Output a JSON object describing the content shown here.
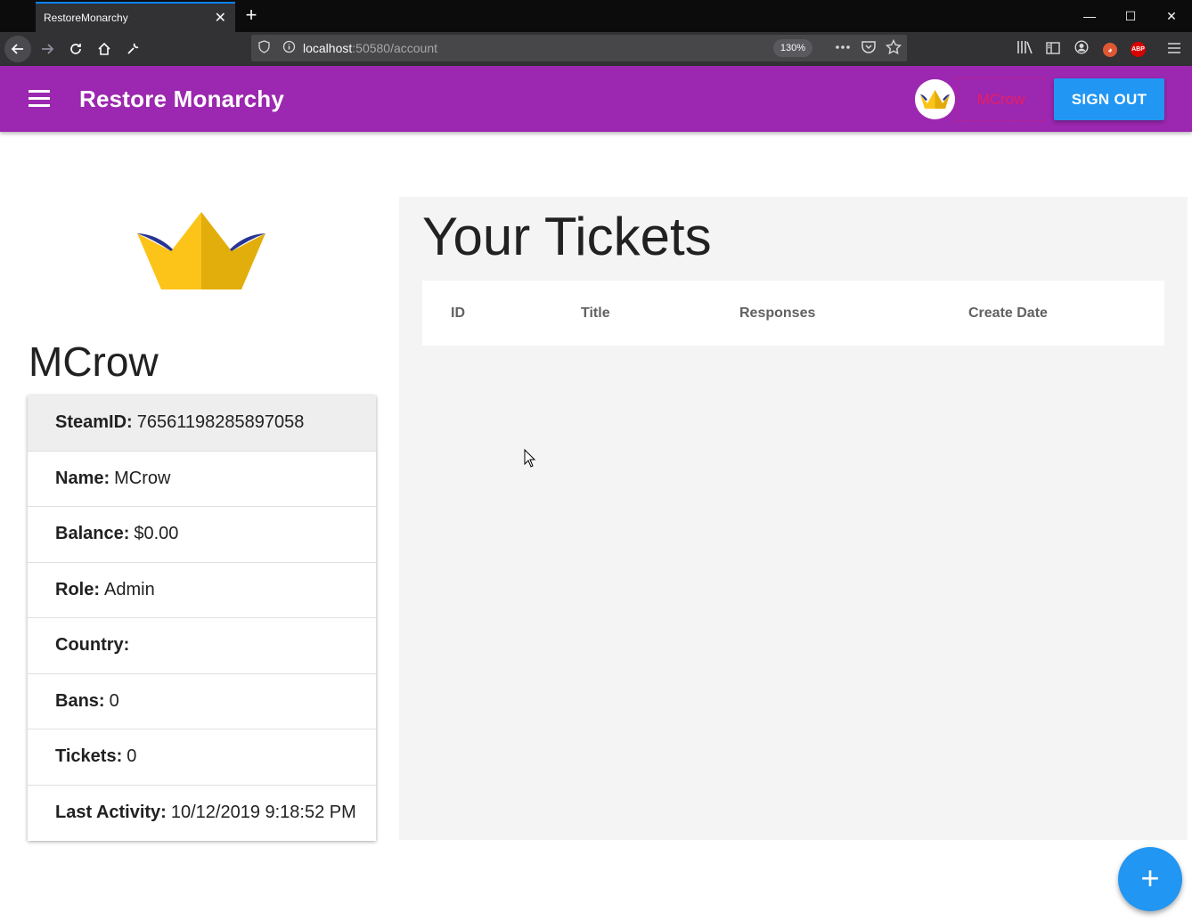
{
  "browser": {
    "tab_title": "RestoreMonarchy",
    "tab_close": "✕",
    "new_tab": "+",
    "url_host": "localhost",
    "url_rest": ":50580/account",
    "zoom": "130%",
    "win_minimize": "—",
    "win_maximize": "☐",
    "win_close": "✕",
    "ext_abp": "ABP",
    "ext_ddg": "◕"
  },
  "appbar": {
    "title": "Restore Monarchy",
    "user_label": "MCrow",
    "signout_label": "SIGN OUT",
    "accent": "#9c27b0"
  },
  "profile": {
    "username": "MCrow",
    "fields": [
      {
        "label": "SteamID:",
        "value": "76561198285897058"
      },
      {
        "label": "Name:",
        "value": "MCrow"
      },
      {
        "label": "Balance:",
        "value": "$0.00"
      },
      {
        "label": "Role:",
        "value": "Admin"
      },
      {
        "label": "Country:",
        "value": ""
      },
      {
        "label": "Bans:",
        "value": "0"
      },
      {
        "label": "Tickets:",
        "value": "0"
      },
      {
        "label": "Last Activity:",
        "value": "10/12/2019 9:18:52 PM"
      }
    ]
  },
  "tickets": {
    "title": "Your Tickets",
    "columns": [
      "ID",
      "Title",
      "Responses",
      "Create Date"
    ],
    "rows": []
  },
  "fab": {
    "label": "+"
  }
}
